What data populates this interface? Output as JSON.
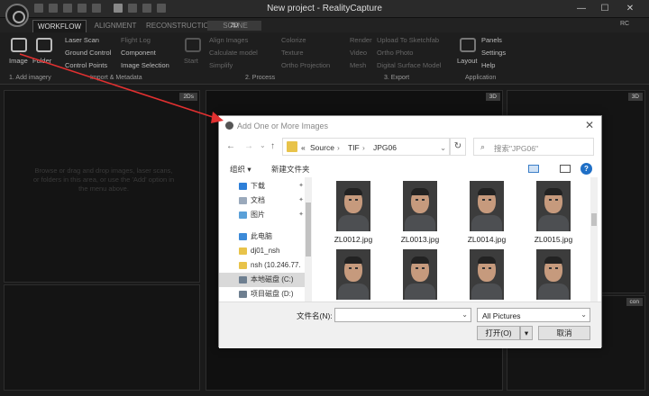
{
  "window": {
    "title": "New project - RealityCapture",
    "controls": [
      "—",
      "☐",
      "✕"
    ],
    "rc_label": "RC"
  },
  "tabs": [
    {
      "label": "WORKFLOW",
      "active": true
    },
    {
      "label": "ALIGNMENT"
    },
    {
      "label": "RECONSTRUCTION"
    },
    {
      "label": "SCENE"
    }
  ],
  "view_tabs": {
    "left": "2D",
    "right": "3D"
  },
  "ribbon": {
    "image_btn": "Image",
    "folder_btn": "Folder",
    "import_col1": [
      "Laser Scan",
      "Ground Control",
      "Control Points"
    ],
    "import_col2": [
      "Flight Log",
      "Component",
      "Image Selection"
    ],
    "start_btn": "Start",
    "process_col1": [
      "Align Images",
      "Calculate model",
      "Simplify"
    ],
    "process_col2": [
      "Colorize",
      "Texture",
      "Ortho Projection"
    ],
    "export_col1": [
      "Render",
      "Video",
      "Mesh"
    ],
    "export_col2": [
      "Upload To Sketchfab",
      "Ortho Photo",
      "Digital Surface Model"
    ],
    "layout_btn": "Layout",
    "app_col": [
      "Panels",
      "Settings",
      "Help"
    ],
    "sections": [
      "1. Add imagery",
      "Import & Metadata",
      "2. Process",
      "3. Export",
      "Application"
    ]
  },
  "panels": {
    "badge_2ds": "2Ds",
    "badge_3d": "3D",
    "badge_3d_right": "3D",
    "badge_con": "con",
    "hint_left": "Browse or drag and drop images, laser scans, or folders in this area, or use the 'Add' option in the menu above."
  },
  "dialog": {
    "title": "Add One or More Images",
    "close": "✕",
    "nav": {
      "back": "←",
      "forward": "→",
      "recent": "⌄",
      "up": "↑"
    },
    "breadcrumb": [
      "«",
      "Source",
      "›",
      "TIF",
      "›",
      "JPG06",
      "⌄"
    ],
    "refresh": "↻",
    "search_placeholder": "搜索\"JPG06\"",
    "toolbar": {
      "organize": "组织 ▾",
      "new_folder": "新建文件夹",
      "help": "?"
    },
    "tree": [
      {
        "label": "下载",
        "icon": "download-icon",
        "color": "#2d7fd8",
        "pinned": true
      },
      {
        "label": "文档",
        "icon": "document-icon",
        "color": "#9aa9bb",
        "pinned": true
      },
      {
        "label": "图片",
        "icon": "picture-icon",
        "color": "#5aa0d8",
        "pinned": true
      },
      {
        "label": "此电脑",
        "icon": "computer-icon",
        "color": "#3c8ad8",
        "pinned": false
      },
      {
        "label": "dj01_nsh",
        "icon": "network-drive-icon",
        "color": "#e8c34a",
        "pinned": false
      },
      {
        "label": "nsh (10.246.77.",
        "icon": "network-drive-icon",
        "color": "#e8c34a",
        "pinned": false
      },
      {
        "label": "本地磁盘 (C:)",
        "icon": "drive-icon",
        "color": "#6e7f90",
        "pinned": false,
        "selected": true
      },
      {
        "label": "项目磁盘 (D:)",
        "icon": "drive-icon",
        "color": "#6e7f90",
        "pinned": false
      }
    ],
    "files": [
      {
        "name": "ZL0012.jpg"
      },
      {
        "name": "ZL0013.jpg"
      },
      {
        "name": "ZL0014.jpg"
      },
      {
        "name": "ZL0015.jpg"
      },
      {
        "name": ""
      },
      {
        "name": ""
      },
      {
        "name": ""
      },
      {
        "name": ""
      }
    ],
    "filename_label": "文件名(N):",
    "filename_value": "",
    "filetype_value": "All Pictures",
    "open_btn": "打开(O)",
    "open_dropdown": "▾",
    "cancel_btn": "取消"
  }
}
